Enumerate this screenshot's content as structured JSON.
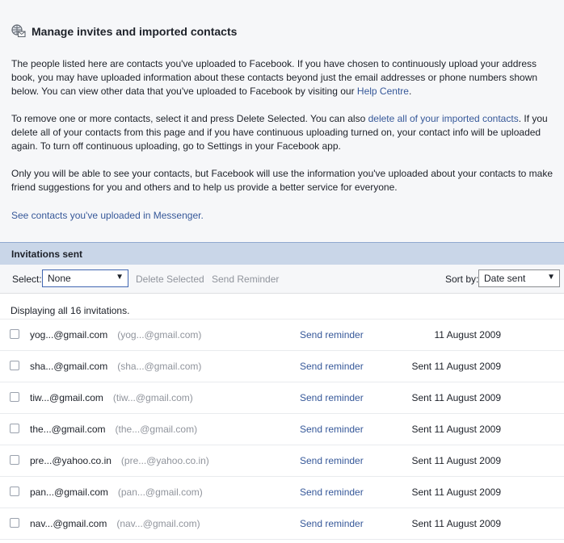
{
  "header": {
    "title": "Manage invites and imported contacts",
    "icon": "contacts-mail-icon"
  },
  "intro": {
    "p1_text": "The people listed here are contacts you've uploaded to Facebook. If you have chosen to continuously upload your address book, you may have uploaded information about these contacts beyond just the email addresses or phone numbers shown below. You can view other data that you've uploaded to Facebook by visiting our ",
    "p1_link": "Help Centre",
    "p1_end": ".",
    "p2_text": "To remove one or more contacts, select it and press Delete Selected. You can also ",
    "p2_link": "delete all of your imported contacts",
    "p2_end": ". If you delete all of your contacts from this page and if you have continuous uploading turned on, your contact info will be uploaded again. To turn off continuous uploading, go to Settings in your Facebook app.",
    "p3_text": "Only you will be able to see your contacts, but Facebook will use the information you've uploaded about your contacts to make friend suggestions for you and others and to help us provide a better service for everyone.",
    "p4_link": "See contacts you've uploaded in Messenger."
  },
  "invitations": {
    "bar_title": "Invitations sent",
    "select_label": "Select:",
    "select_value": "None",
    "delete_label": "Delete Selected",
    "reminder_label": "Send Reminder",
    "sort_label": "Sort by:",
    "sort_value": "Date sent",
    "count_text": "Displaying all 16 invitations.",
    "rows": [
      {
        "email": "yog...@gmail.com",
        "email2": "(yog...@gmail.com)",
        "action": "Send reminder",
        "date": "11 August 2009"
      },
      {
        "email": "sha...@gmail.com",
        "email2": "(sha...@gmail.com)",
        "action": "Send reminder",
        "date": "Sent 11 August 2009"
      },
      {
        "email": "tiw...@gmail.com",
        "email2": "(tiw...@gmail.com)",
        "action": "Send reminder",
        "date": "Sent 11 August 2009"
      },
      {
        "email": "the...@gmail.com",
        "email2": "(the...@gmail.com)",
        "action": "Send reminder",
        "date": "Sent 11 August 2009"
      },
      {
        "email": "pre...@yahoo.co.in",
        "email2": "(pre...@yahoo.co.in)",
        "action": "Send reminder",
        "date": "Sent 11 August 2009"
      },
      {
        "email": "pan...@gmail.com",
        "email2": "(pan...@gmail.com)",
        "action": "Send reminder",
        "date": "Sent 11 August 2009"
      },
      {
        "email": "nav...@gmail.com",
        "email2": "(nav...@gmail.com)",
        "action": "Send reminder",
        "date": "Sent 11 August 2009"
      }
    ]
  },
  "colors": {
    "link": "#365899",
    "bar_bg": "#c9d6e8",
    "page_bg": "#f6f7f9"
  }
}
